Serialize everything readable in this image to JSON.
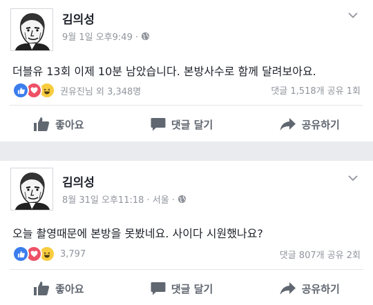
{
  "posts": [
    {
      "author": "김의성",
      "meta": "9월 1일 오후9:49 ·",
      "text": "더블유 13회 이제 10분 남았습니다. 본방사수로 함께 달려보아요.",
      "reactions_text": "권유진님 외 3,348명",
      "stats": "댓글 1,518개 공유 1회"
    },
    {
      "author": "김의성",
      "meta": "8월 31일 오후11:18 · 서울 ·",
      "text": "오늘 촬영때문에 본방을 못봤네요. 사이다 시원했나요?",
      "reactions_text": "3,797",
      "stats": "댓글 807개 공유 2회"
    }
  ],
  "actions": {
    "like": "좋아요",
    "comment": "댓글 달기",
    "share": "공유하기"
  },
  "icons": {
    "avatar": "portrait-sketch-icon",
    "privacy": "globe-icon",
    "menu": "chevron-down-icon",
    "like_reaction": "thumbs-up-icon",
    "love_reaction": "heart-icon",
    "haha_reaction": "laughing-face-icon",
    "like_action": "thumb-icon",
    "comment_action": "speech-bubble-icon",
    "share_action": "share-arrow-icon"
  },
  "colors": {
    "like_blue": "#3b7ded",
    "love_red": "#ed5167",
    "haha_yellow": "#f8cc3f",
    "meta_gray": "#90949c",
    "action_gray": "#606770",
    "separator": "#e9ebee"
  }
}
